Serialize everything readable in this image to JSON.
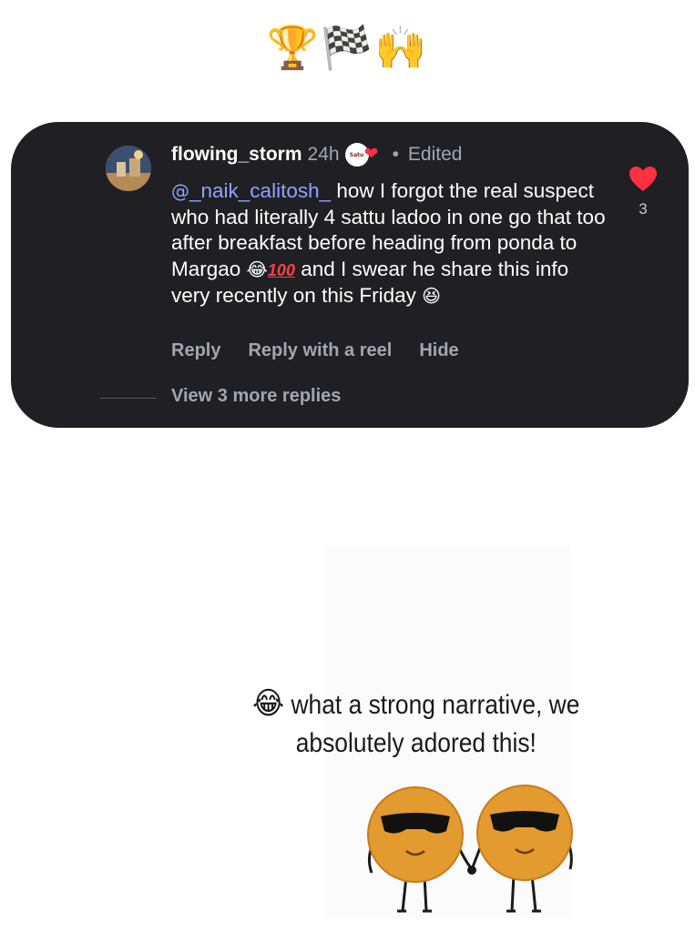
{
  "header": {
    "emojis": "🏆🏁🙌"
  },
  "comment": {
    "username": "flowing_storm",
    "time": "24h",
    "badge_text": "Satu",
    "badge_heart": "❤",
    "separator": "•",
    "status": "Edited",
    "mention_glyph": "@",
    "mention": "_naik_calitosh_",
    "text_line1": " how I forgot the real suspect who had literally 4 sattu ladoo in one go that too after breakfast before heading from ponda to Margao ",
    "emoji_laugh": "😂",
    "emoji_hundred": "100",
    "text_line2": " and I swear he share this info very recently on this Friday ",
    "emoji_grin": "😆",
    "like_count": "3",
    "actions": {
      "reply": "Reply",
      "reply_reel": "Reply with a reel",
      "hide": "Hide"
    },
    "view_more": "View 3 more replies"
  },
  "sticker": {
    "emoji": "😂",
    "caption": "what a strong narrative, we absolutely adored this!"
  },
  "colors": {
    "card_bg": "#1f1f24",
    "mention": "#8fa3ff",
    "muted": "#a3a6ad",
    "like_red": "#ff3040",
    "laddoo": "#e39a2f"
  }
}
